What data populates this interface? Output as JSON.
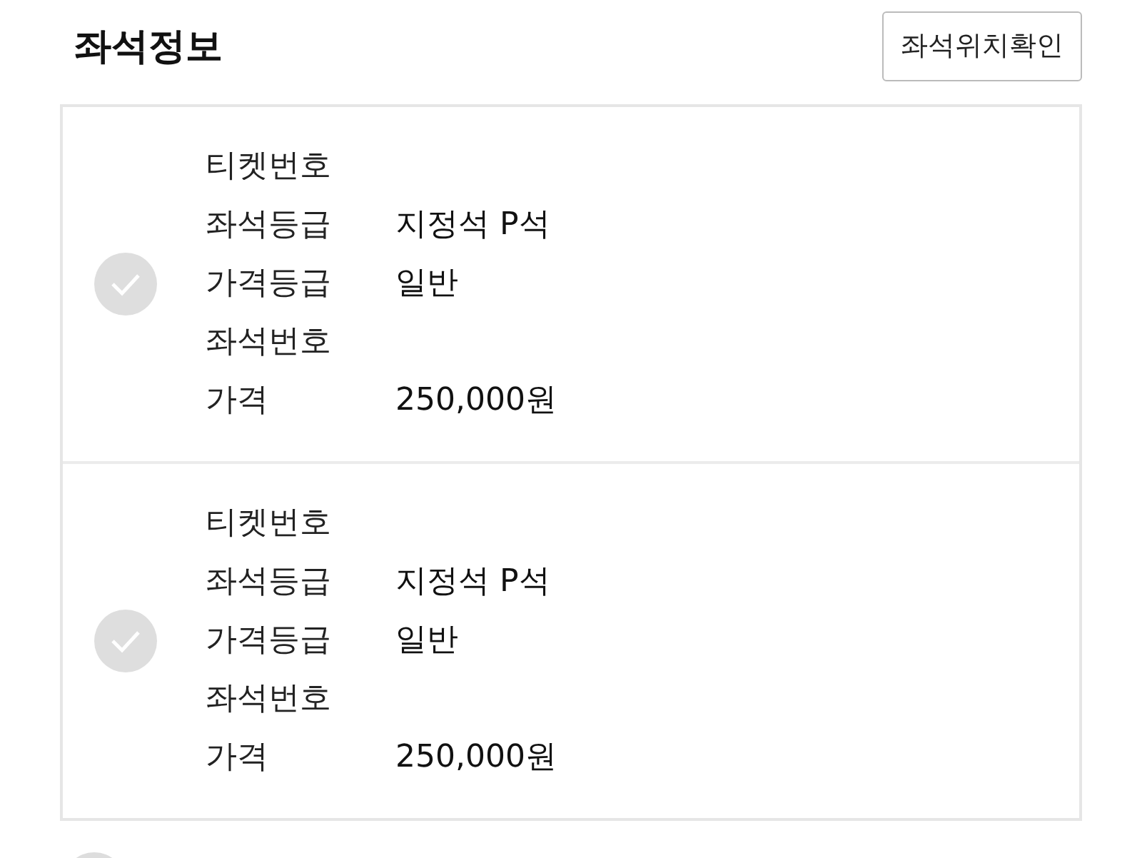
{
  "header": {
    "title": "좌석정보",
    "button": "좌석위치확인"
  },
  "seats": [
    {
      "checked": false,
      "fields": [
        {
          "label": "티켓번호"
        },
        {
          "label": "좌석등급",
          "value": "지정석 P석"
        },
        {
          "label": "가격등급",
          "value": "일반"
        },
        {
          "label": "좌석번호"
        },
        {
          "label": "가격",
          "value": "250,000원"
        }
      ]
    },
    {
      "checked": false,
      "fields": [
        {
          "label": "티켓번호"
        },
        {
          "label": "좌석등급",
          "value": "지정석 P석"
        },
        {
          "label": "가격등급",
          "value": "일반"
        },
        {
          "label": "좌석번호"
        },
        {
          "label": "가격",
          "value": "250,000원"
        }
      ]
    }
  ]
}
